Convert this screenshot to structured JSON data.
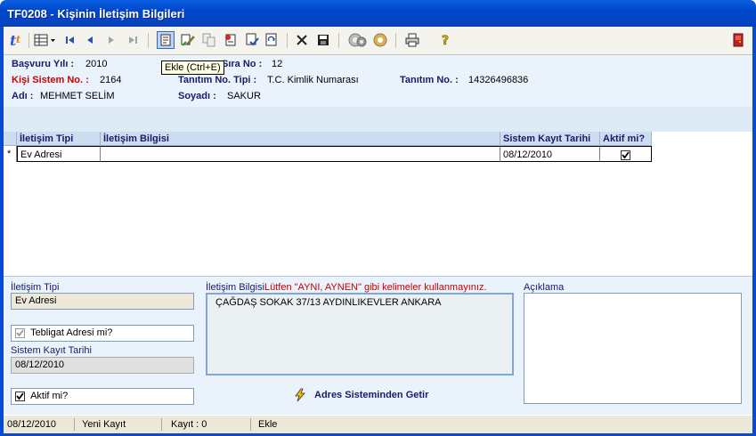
{
  "window": {
    "title": "TF0208 - Kişinin İletişim Bilgileri"
  },
  "tooltip": "Ekle (Ctrl+E)",
  "header": {
    "basvuru_yili_label": "Başvuru Yılı :",
    "basvuru_yili_value": "2010",
    "sira_no_label": "Sıra No :",
    "sira_no_value": "12",
    "kisi_sistem_no_label": "Kişi Sistem No. :",
    "kisi_sistem_no_value": "2164",
    "tanitim_no_tipi_label": "Tanıtım No. Tipi :",
    "tanitim_no_tipi_value": "T.C. Kimlik Numarası",
    "tanitim_no_label": "Tanıtım No. :",
    "tanitim_no_value": "14326496836",
    "adi_label": "Adı :",
    "adi_value": "MEHMET SELİM",
    "soyadi_label": "Soyadı :",
    "soyadi_value": "SAKUR"
  },
  "grid": {
    "columns": [
      "İletişim Tipi",
      "İletişim Bilgisi",
      "Sistem Kayıt Tarihi",
      "Aktif mi?"
    ],
    "row_marker": "*",
    "rows": [
      {
        "tip": "Ev Adresi",
        "bilgi": "",
        "tarih": "08/12/2010",
        "aktif": true
      }
    ]
  },
  "form": {
    "iletisim_tipi_label": "İletişim Tipi",
    "iletisim_tipi_value": "Ev Adresi",
    "tebligat_label": "Tebligat Adresi mi?",
    "tebligat_checked": true,
    "sistem_kayit_label": "Sistem Kayıt Tarihi",
    "sistem_kayit_value": "08/12/2010",
    "aktif_label": "Aktif mi?",
    "aktif_checked": true,
    "iletisim_bilgisi_label": "İletişim Bilgisi",
    "warning": "Lütfen \"AYNI, AYNEN\" gibi kelimeler kullanmayınız.",
    "iletisim_bilgisi_value": "ÇAĞDAŞ SOKAK 37/13 AYDINLIKEVLER ANKARA",
    "aciklama_label": "Açıklama",
    "aciklama_value": "",
    "adres_button": "Adres Sisteminden Getir"
  },
  "status": {
    "date": "08/12/2010",
    "mode": "Yeni Kayıt",
    "kayit": "Kayıt : 0",
    "action": "Ekle"
  },
  "icons": [
    "app-logo-icon",
    "grid-view-icon",
    "first-record-icon",
    "prev-record-icon",
    "next-record-icon",
    "last-record-icon",
    "add-record-icon",
    "edit-record-icon",
    "copy-record-icon",
    "insert-record-icon",
    "check-record-icon",
    "refresh-icon",
    "delete-icon",
    "save-icon",
    "gear-icon",
    "print-icon",
    "help-icon",
    "exit-icon",
    "lightning-icon"
  ],
  "colors": {
    "title_bar": "#0047cc",
    "label_blue": "#1a1a6a",
    "label_red": "#cc0000",
    "panel_bg": "#eaf2fb",
    "grid_header": "#ccddf0"
  }
}
